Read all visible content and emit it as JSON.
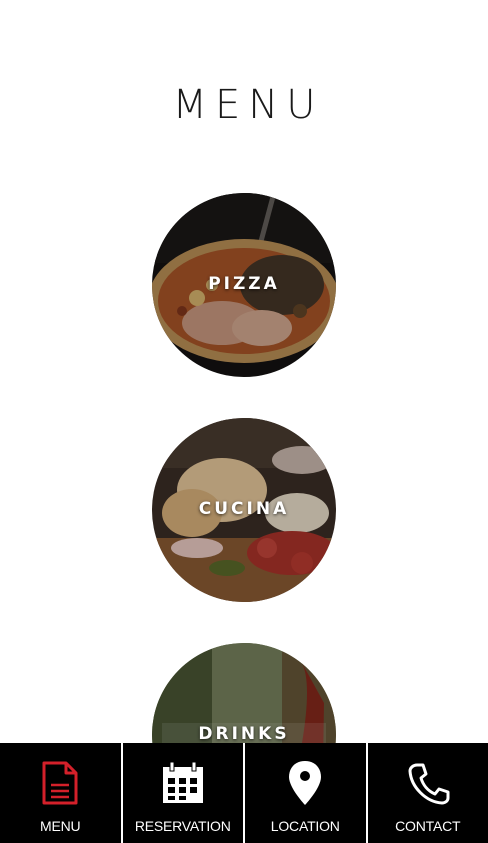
{
  "page": {
    "title": "MENU"
  },
  "categories": [
    {
      "label": "PIZZA"
    },
    {
      "label": "CUCINA"
    },
    {
      "label": "DRINKS"
    }
  ],
  "tabbar": {
    "active_color": "#d4202a",
    "items": [
      {
        "label": "MENU",
        "icon": "document-icon",
        "active": true
      },
      {
        "label": "RESERVATION",
        "icon": "calendar-icon",
        "active": false
      },
      {
        "label": "LOCATION",
        "icon": "map-pin-icon",
        "active": false
      },
      {
        "label": "CONTACT",
        "icon": "phone-icon",
        "active": false
      }
    ]
  }
}
